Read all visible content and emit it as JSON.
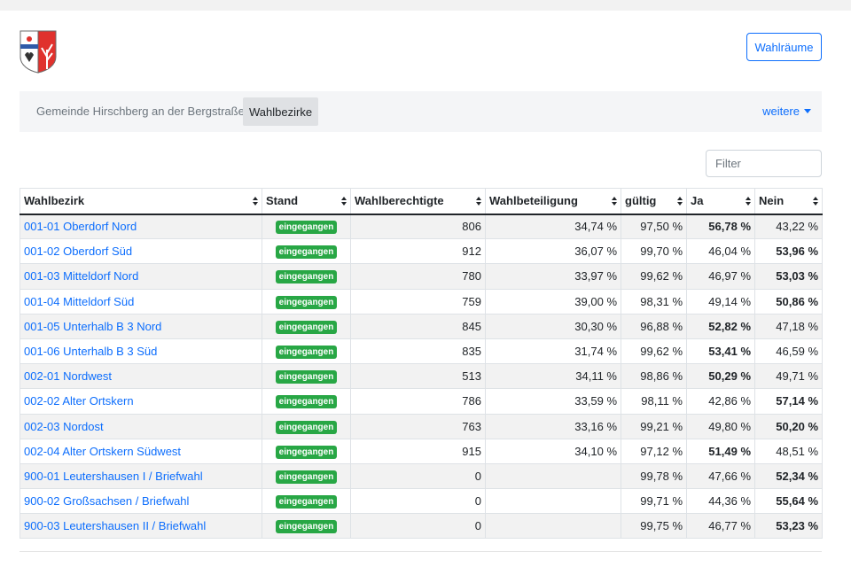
{
  "header": {
    "logo_icon": "coat-of-arms-icon",
    "button_label": "Wahlräume"
  },
  "breadcrumb": {
    "items": [
      "Gemeinde Hirschberg an der Bergstraße",
      "Wahlbezirke"
    ],
    "more_label": "weitere"
  },
  "filter": {
    "placeholder": "Filter"
  },
  "table": {
    "columns": [
      "Wahlbezirk",
      "Stand",
      "Wahlberechtigte",
      "Wahlbeteiligung",
      "gültig",
      "Ja",
      "Nein"
    ],
    "rows": [
      {
        "name": "001-01 Oberdorf Nord",
        "stand": "eingegangen",
        "berechtigte": "806",
        "beteiligung": "34,74 %",
        "gueltig": "97,50 %",
        "ja": "56,78 %",
        "nein": "43,22 %",
        "winner": "ja"
      },
      {
        "name": "001-02 Oberdorf Süd",
        "stand": "eingegangen",
        "berechtigte": "912",
        "beteiligung": "36,07 %",
        "gueltig": "99,70 %",
        "ja": "46,04 %",
        "nein": "53,96 %",
        "winner": "nein"
      },
      {
        "name": "001-03 Mitteldorf Nord",
        "stand": "eingegangen",
        "berechtigte": "780",
        "beteiligung": "33,97 %",
        "gueltig": "99,62 %",
        "ja": "46,97 %",
        "nein": "53,03 %",
        "winner": "nein"
      },
      {
        "name": "001-04 Mitteldorf Süd",
        "stand": "eingegangen",
        "berechtigte": "759",
        "beteiligung": "39,00 %",
        "gueltig": "98,31 %",
        "ja": "49,14 %",
        "nein": "50,86 %",
        "winner": "nein"
      },
      {
        "name": "001-05 Unterhalb B 3 Nord",
        "stand": "eingegangen",
        "berechtigte": "845",
        "beteiligung": "30,30 %",
        "gueltig": "96,88 %",
        "ja": "52,82 %",
        "nein": "47,18 %",
        "winner": "ja"
      },
      {
        "name": "001-06 Unterhalb B 3 Süd",
        "stand": "eingegangen",
        "berechtigte": "835",
        "beteiligung": "31,74 %",
        "gueltig": "99,62 %",
        "ja": "53,41 %",
        "nein": "46,59 %",
        "winner": "ja"
      },
      {
        "name": "002-01 Nordwest",
        "stand": "eingegangen",
        "berechtigte": "513",
        "beteiligung": "34,11 %",
        "gueltig": "98,86 %",
        "ja": "50,29 %",
        "nein": "49,71 %",
        "winner": "ja"
      },
      {
        "name": "002-02 Alter Ortskern",
        "stand": "eingegangen",
        "berechtigte": "786",
        "beteiligung": "33,59 %",
        "gueltig": "98,11 %",
        "ja": "42,86 %",
        "nein": "57,14 %",
        "winner": "nein"
      },
      {
        "name": "002-03 Nordost",
        "stand": "eingegangen",
        "berechtigte": "763",
        "beteiligung": "33,16 %",
        "gueltig": "99,21 %",
        "ja": "49,80 %",
        "nein": "50,20 %",
        "winner": "nein"
      },
      {
        "name": "002-04 Alter Ortskern Südwest",
        "stand": "eingegangen",
        "berechtigte": "915",
        "beteiligung": "34,10 %",
        "gueltig": "97,12 %",
        "ja": "51,49 %",
        "nein": "48,51 %",
        "winner": "ja"
      },
      {
        "name": "900-01 Leutershausen I / Briefwahl",
        "stand": "eingegangen",
        "berechtigte": "0",
        "beteiligung": "",
        "gueltig": "99,78 %",
        "ja": "47,66 %",
        "nein": "52,34 %",
        "winner": "nein"
      },
      {
        "name": "900-02 Großsachsen / Briefwahl",
        "stand": "eingegangen",
        "berechtigte": "0",
        "beteiligung": "",
        "gueltig": "99,71 %",
        "ja": "44,36 %",
        "nein": "55,64 %",
        "winner": "nein"
      },
      {
        "name": "900-03 Leutershausen II / Briefwahl",
        "stand": "eingegangen",
        "berechtigte": "0",
        "beteiligung": "",
        "gueltig": "99,75 %",
        "ja": "46,77 %",
        "nein": "53,23 %",
        "winner": "nein"
      }
    ]
  },
  "colors": {
    "accent": "#0d6efd",
    "badge": "#28a745",
    "stripe": "#f2f2f2"
  }
}
